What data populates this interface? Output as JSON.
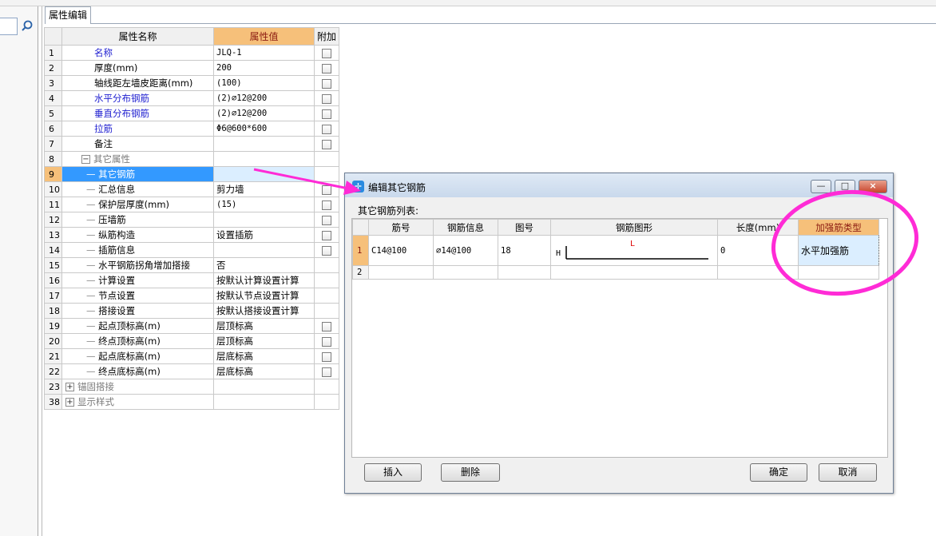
{
  "tab": {
    "label": "属性编辑"
  },
  "grid": {
    "headers": {
      "name": "属性名称",
      "value": "属性值",
      "extra": "附加"
    },
    "rows": [
      {
        "num": "1",
        "name": "名称",
        "value": "JLQ-1"
      },
      {
        "num": "2",
        "name": "厚度(mm)",
        "value": "200"
      },
      {
        "num": "3",
        "name": "轴线距左墙皮距离(mm)",
        "value": "(100)"
      },
      {
        "num": "4",
        "name": "水平分布钢筋",
        "value": "(2)⌀12@200"
      },
      {
        "num": "5",
        "name": "垂直分布钢筋",
        "value": "(2)⌀12@200"
      },
      {
        "num": "6",
        "name": "拉筋",
        "value": "Φ6@600*600"
      },
      {
        "num": "7",
        "name": "备注",
        "value": ""
      },
      {
        "num": "8",
        "name": "其它属性",
        "value": ""
      },
      {
        "num": "9",
        "name": "其它钢筋",
        "value": ""
      },
      {
        "num": "10",
        "name": "汇总信息",
        "value": "剪力墙"
      },
      {
        "num": "11",
        "name": "保护层厚度(mm)",
        "value": "(15)"
      },
      {
        "num": "12",
        "name": "压墙筋",
        "value": ""
      },
      {
        "num": "13",
        "name": "纵筋构造",
        "value": "设置插筋"
      },
      {
        "num": "14",
        "name": "插筋信息",
        "value": ""
      },
      {
        "num": "15",
        "name": "水平钢筋拐角增加搭接",
        "value": "否"
      },
      {
        "num": "16",
        "name": "计算设置",
        "value": "按默认计算设置计算"
      },
      {
        "num": "17",
        "name": "节点设置",
        "value": "按默认节点设置计算"
      },
      {
        "num": "18",
        "name": "搭接设置",
        "value": "按默认搭接设置计算"
      },
      {
        "num": "19",
        "name": "起点顶标高(m)",
        "value": "层顶标高"
      },
      {
        "num": "20",
        "name": "终点顶标高(m)",
        "value": "层顶标高"
      },
      {
        "num": "21",
        "name": "起点底标高(m)",
        "value": "层底标高"
      },
      {
        "num": "22",
        "name": "终点底标高(m)",
        "value": "层底标高"
      },
      {
        "num": "23",
        "name": "锚固搭接",
        "value": ""
      },
      {
        "num": "38",
        "name": "显示样式",
        "value": ""
      }
    ]
  },
  "dialog": {
    "title": "编辑其它钢筋",
    "list_label": "其它钢筋列表:",
    "headers": {
      "bar_no": "筋号",
      "rebar_info": "钢筋信息",
      "figure_no": "图号",
      "rebar_shape": "钢筋图形",
      "length": "长度(mm)",
      "reinforce_type": "加强筋类型"
    },
    "rows": [
      {
        "num": "1",
        "bar_no": "C14@100",
        "rebar_info": "⌀14@100",
        "figure_no": "18",
        "shape_h": "H",
        "shape_l": "L",
        "length": "0",
        "reinforce_type": "水平加强筋"
      },
      {
        "num": "2",
        "bar_no": "",
        "rebar_info": "",
        "figure_no": "",
        "length": "",
        "reinforce_type": ""
      }
    ],
    "buttons": {
      "insert": "插入",
      "delete": "删除",
      "ok": "确定",
      "cancel": "取消"
    },
    "window_buttons": {
      "minimize": "—",
      "maximize": "□",
      "close": "×"
    }
  },
  "colors": {
    "accent_header": "#f6c07a",
    "selection": "#3399ff",
    "annotation": "#ff2bd6"
  }
}
